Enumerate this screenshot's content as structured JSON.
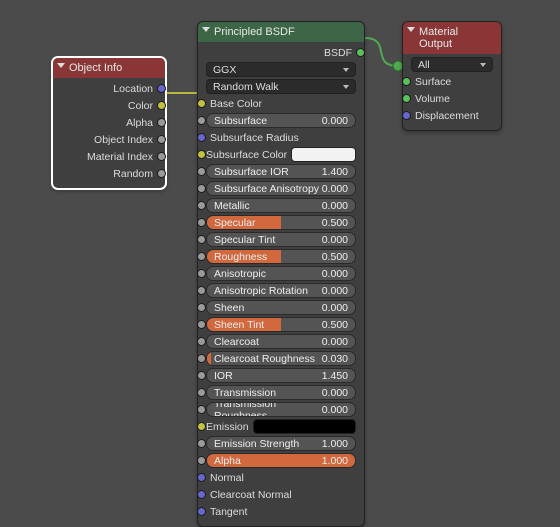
{
  "object_info": {
    "title": "Object Info",
    "outputs": [
      {
        "name": "Location",
        "type": "vec"
      },
      {
        "name": "Color",
        "type": "color"
      },
      {
        "name": "Alpha",
        "type": "float"
      },
      {
        "name": "Object Index",
        "type": "float"
      },
      {
        "name": "Material Index",
        "type": "float"
      },
      {
        "name": "Random",
        "type": "float"
      }
    ]
  },
  "bsdf": {
    "title": "Principled BSDF",
    "output": "BSDF",
    "distribution": "GGX",
    "subsurface_method": "Random Walk",
    "labels": {
      "base_color": "Base Color",
      "subsurface_radius": "Subsurface Radius",
      "subsurface_color": "Subsurface Color",
      "subsurface_color_value": "#f2f2f2",
      "emission": "Emission",
      "emission_value": "#000000",
      "normal": "Normal",
      "clearcoat_normal": "Clearcoat Normal",
      "tangent": "Tangent"
    },
    "sliders": [
      {
        "name": "Subsurface",
        "value": "0.000",
        "fill": 0
      },
      {
        "name": "Subsurface IOR",
        "value": "1.400",
        "fill": 0
      },
      {
        "name": "Subsurface Anisotropy",
        "value": "0.000",
        "fill": 0
      },
      {
        "name": "Metallic",
        "value": "0.000",
        "fill": 0
      },
      {
        "name": "Specular",
        "value": "0.500",
        "fill": 50
      },
      {
        "name": "Specular Tint",
        "value": "0.000",
        "fill": 0
      },
      {
        "name": "Roughness",
        "value": "0.500",
        "fill": 50
      },
      {
        "name": "Anisotropic",
        "value": "0.000",
        "fill": 0
      },
      {
        "name": "Anisotropic Rotation",
        "value": "0.000",
        "fill": 0
      },
      {
        "name": "Sheen",
        "value": "0.000",
        "fill": 0
      },
      {
        "name": "Sheen Tint",
        "value": "0.500",
        "fill": 50
      },
      {
        "name": "Clearcoat",
        "value": "0.000",
        "fill": 0
      },
      {
        "name": "Clearcoat Roughness",
        "value": "0.030",
        "fill": 3
      },
      {
        "name": "IOR",
        "value": "1.450",
        "fill": 0
      },
      {
        "name": "Transmission",
        "value": "0.000",
        "fill": 0
      },
      {
        "name": "Transmission Roughness",
        "value": "0.000",
        "fill": 0
      },
      {
        "name": "Emission Strength",
        "value": "1.000",
        "fill": 0
      },
      {
        "name": "Alpha",
        "value": "1.000",
        "fill": 100
      }
    ]
  },
  "mat_out": {
    "title": "Material Output",
    "target": "All",
    "inputs": [
      {
        "name": "Surface",
        "type": "shader"
      },
      {
        "name": "Volume",
        "type": "shader"
      },
      {
        "name": "Displacement",
        "type": "vec"
      }
    ]
  }
}
